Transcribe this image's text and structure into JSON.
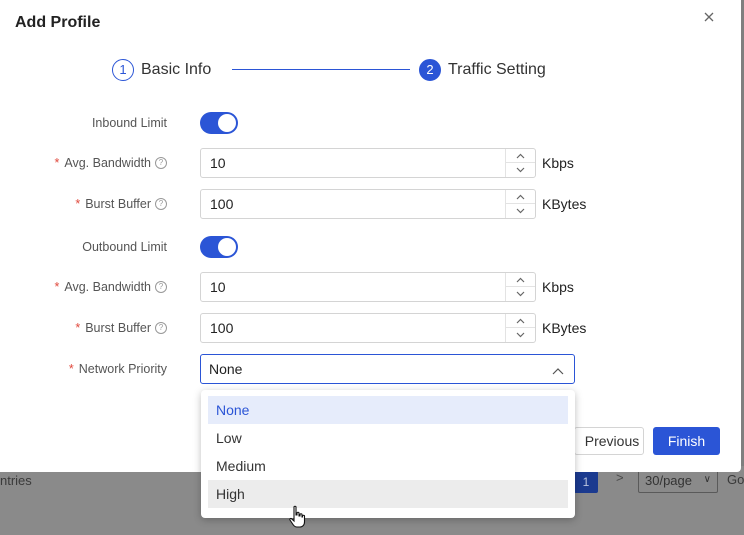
{
  "modal": {
    "title": "Add Profile",
    "close_icon": "close-icon",
    "steps": [
      {
        "number": "1",
        "label": "Basic Info",
        "state": "done"
      },
      {
        "number": "2",
        "label": "Traffic Setting",
        "state": "active"
      }
    ]
  },
  "form": {
    "inbound_limit": {
      "label": "Inbound Limit",
      "enabled": true
    },
    "inbound_avg_bandwidth": {
      "label": "Avg. Bandwidth",
      "value": "10",
      "unit": "Kbps",
      "required": "*"
    },
    "inbound_burst_buffer": {
      "label": "Burst Buffer",
      "value": "100",
      "unit": "KBytes",
      "required": "*"
    },
    "outbound_limit": {
      "label": "Outbound Limit",
      "enabled": true
    },
    "outbound_avg_bandwidth": {
      "label": "Avg. Bandwidth",
      "value": "10",
      "unit": "Kbps",
      "required": "*"
    },
    "outbound_burst_buffer": {
      "label": "Burst Buffer",
      "value": "100",
      "unit": "KBytes",
      "required": "*"
    },
    "network_priority": {
      "label": "Network Priority",
      "required": "*",
      "value": "None",
      "options": [
        "None",
        "Low",
        "Medium",
        "High"
      ]
    },
    "help_glyph": "?"
  },
  "buttons": {
    "previous": "Previous",
    "finish": "Finish"
  },
  "background": {
    "entries_text": "ntries",
    "current_page": "1",
    "next_glyph": ">",
    "page_size": "30/page",
    "go_text": "Go"
  },
  "colors": {
    "accent": "#2b55d6",
    "required": "#e0483c",
    "overlay": "#7f7f7f"
  }
}
